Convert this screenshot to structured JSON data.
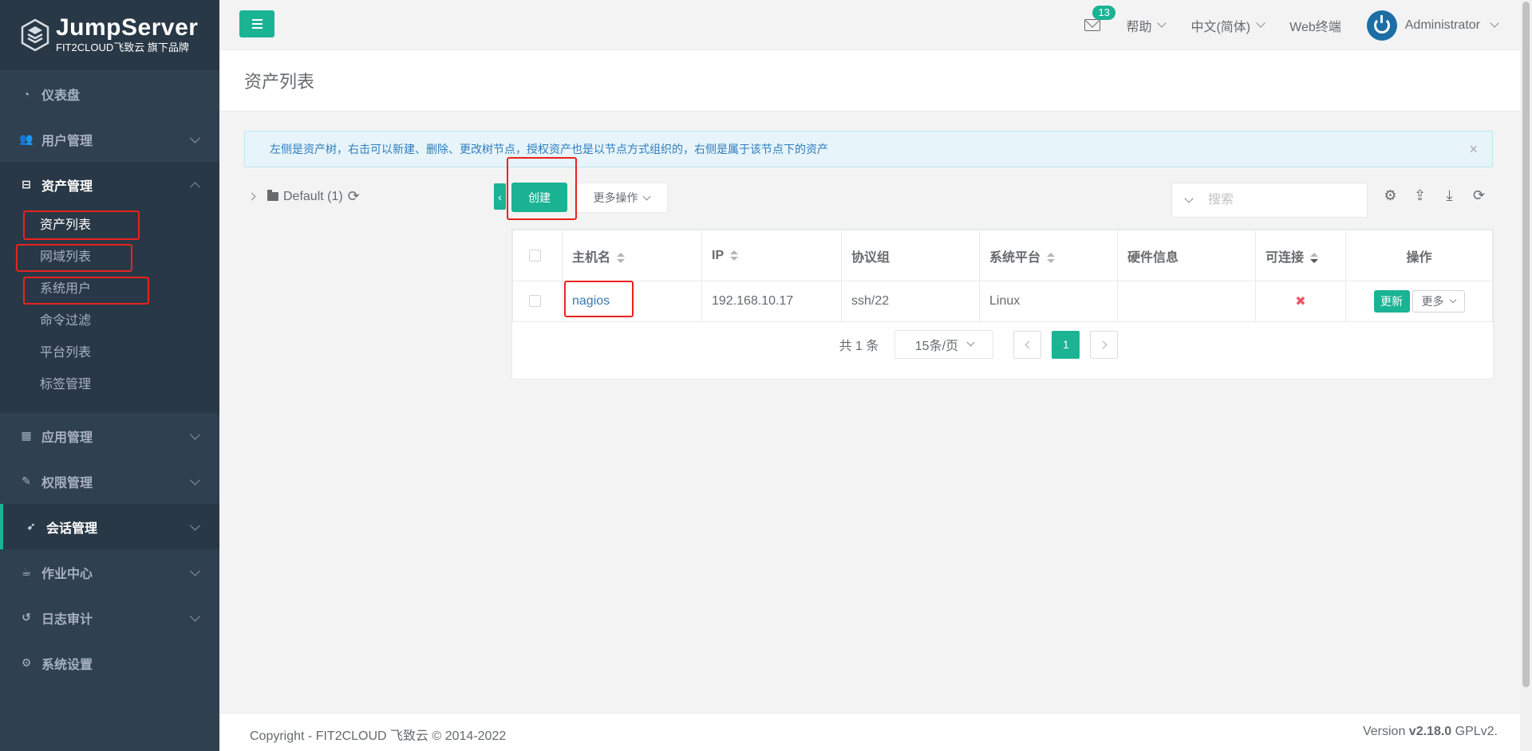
{
  "brand": {
    "title": "JumpServer",
    "subtitle": "FIT2CLOUD飞致云 旗下品牌"
  },
  "sidebar": {
    "items": [
      {
        "label": "仪表盘",
        "icon": "dashboard-icon"
      },
      {
        "label": "用户管理",
        "icon": "users-icon"
      },
      {
        "label": "资产管理",
        "icon": "inbox-icon",
        "expanded": true,
        "children": [
          "资产列表",
          "网域列表",
          "系统用户",
          "命令过滤",
          "平台列表",
          "标签管理"
        ]
      },
      {
        "label": "应用管理",
        "icon": "grid-icon"
      },
      {
        "label": "权限管理",
        "icon": "edit-icon"
      },
      {
        "label": "会话管理",
        "icon": "rocket-icon"
      },
      {
        "label": "作业中心",
        "icon": "coffee-icon"
      },
      {
        "label": "日志审计",
        "icon": "history-icon"
      },
      {
        "label": "系统设置",
        "icon": "gears-icon"
      }
    ]
  },
  "header": {
    "mail_count": "13",
    "help": "帮助",
    "language": "中文(简体)",
    "web_terminal": "Web终端",
    "user": "Administrator"
  },
  "page": {
    "title": "资产列表",
    "alert": "左侧是资产树，右击可以新建、删除、更改树节点，授权资产也是以节点方式组织的，右侧是属于该节点下的资产",
    "alert_close": "×"
  },
  "tree": {
    "root": "Default (1)"
  },
  "toolbar": {
    "create": "创建",
    "more_actions": "更多操作",
    "search_placeholder": "搜索"
  },
  "table": {
    "headers": [
      "主机名",
      "IP",
      "协议组",
      "系统平台",
      "硬件信息",
      "可连接",
      "操作"
    ],
    "rows": [
      {
        "hostname": "nagios",
        "ip": "192.168.10.17",
        "protocols": "ssh/22",
        "platform": "Linux",
        "hardware": "",
        "connectivity": "✖",
        "update": "更新",
        "more": "更多"
      }
    ]
  },
  "pagination": {
    "total": "共 1 条",
    "page_size": "15条/页",
    "current": "1"
  },
  "footer": {
    "copyright": "Copyright - FIT2CLOUD 飞致云 © 2014-2022",
    "version_prefix": "Version ",
    "version": "v2.18.0",
    "license": " GPLv2."
  },
  "colors": {
    "accent": "#1ab394",
    "sidebar": "#2f4050",
    "annotation": "#e8231e"
  }
}
